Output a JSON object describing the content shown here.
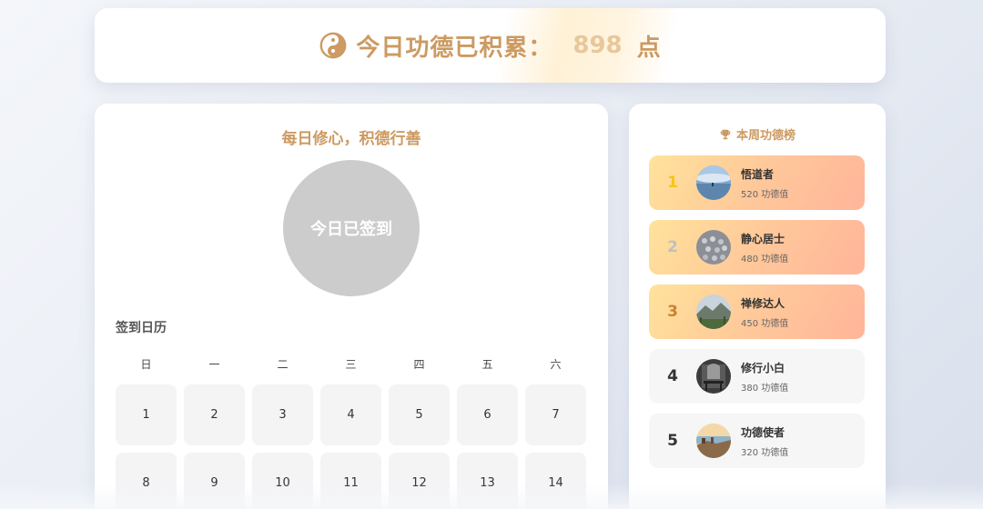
{
  "header": {
    "title": "今日功德已积累：",
    "points": "898",
    "unit": "点",
    "icon": "yin-yang-icon"
  },
  "checkin": {
    "slogan": "每日修心，积德行善",
    "button_label": "今日已签到"
  },
  "calendar": {
    "title": "签到日历",
    "weekdays": [
      "日",
      "一",
      "二",
      "三",
      "四",
      "五",
      "六"
    ],
    "days": [
      "1",
      "2",
      "3",
      "4",
      "5",
      "6",
      "7",
      "8",
      "9",
      "10",
      "11",
      "12",
      "13",
      "14"
    ]
  },
  "leaderboard": {
    "title": "本周功德榜",
    "icon": "trophy-icon",
    "score_suffix": "功德值",
    "entries": [
      {
        "rank": "1",
        "name": "悟道者",
        "score": "520",
        "avatar": "lake-avatar",
        "rank_color": "#f5c518"
      },
      {
        "rank": "2",
        "name": "静心居士",
        "score": "480",
        "avatar": "birds-avatar",
        "rank_color": "#c0c0c0"
      },
      {
        "rank": "3",
        "name": "禅修达人",
        "score": "450",
        "avatar": "mountain-avatar",
        "rank_color": "#cd7f32"
      },
      {
        "rank": "4",
        "name": "修行小白",
        "score": "380",
        "avatar": "room-avatar",
        "rank_color": "#333333"
      },
      {
        "rank": "5",
        "name": "功德使者",
        "score": "320",
        "avatar": "coast-avatar",
        "rank_color": "#333333"
      }
    ]
  },
  "colors": {
    "accent": "#cc9a62",
    "checked_circle": "#cccccc",
    "top_gradient_start": "#ffe39b",
    "top_gradient_end": "#ffb59a"
  }
}
